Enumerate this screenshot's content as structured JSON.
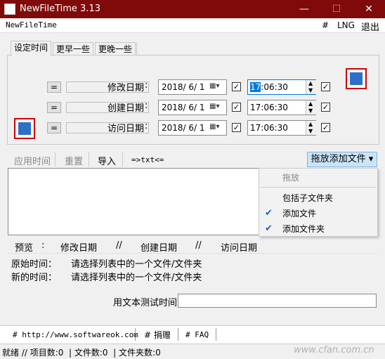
{
  "window": {
    "title": "NewFileTime 3.13",
    "minimize": "—",
    "maximize": "☐",
    "close": "✕"
  },
  "menubar": {
    "app": "NewFileTime",
    "hash": "#",
    "lng": "LNG",
    "exit": "退出"
  },
  "tabs": [
    "设定时间",
    "更早一些",
    "更晚一些"
  ],
  "rows": [
    {
      "eq": "=",
      "label": "修改日期",
      "colon": ":",
      "date": "2018/ 6/ 1",
      "time_hl": "17",
      "time_rest": ":06:30",
      "date_checked": true,
      "time_checked": true
    },
    {
      "eq": "=",
      "label": "创建日期",
      "colon": ":",
      "date": "2018/ 6/ 1",
      "time_hl": "",
      "time_rest": "17:06:30",
      "date_checked": true,
      "time_checked": true
    },
    {
      "eq": "=",
      "label": "访问日期",
      "colon": ":",
      "date": "2018/ 6/ 1",
      "time_hl": "",
      "time_rest": "17:06:30",
      "date_checked": true,
      "time_checked": true
    }
  ],
  "toolbar": {
    "apply": "应用时间",
    "reset": "重置",
    "import": "导入",
    "txt": "=>txt<=",
    "drop": "拖放添加文件 ▾"
  },
  "menu": {
    "header": "拖放",
    "items": [
      {
        "label": "包括子文件夹",
        "checked": false
      },
      {
        "label": "添加文件",
        "checked": true
      },
      {
        "label": "添加文件夹",
        "checked": true
      }
    ]
  },
  "info": {
    "preview": "预览",
    "colon": ":",
    "modified": "修改日期",
    "sep1": "//",
    "created": "创建日期",
    "sep2": "//",
    "accessed": "访问日期",
    "original_label": "原始时间：",
    "original_value": "请选择列表中的一个文件/文件夹",
    "new_label": "新的时间：",
    "new_value": "请选择列表中的一个文件/文件夹",
    "test_label": "用文本测试时间"
  },
  "links": {
    "site": "# http://www.softwareok.com",
    "donate": "# 捐赠",
    "faq": "# FAQ"
  },
  "status": "就绪 // 项目数:0  | 文件数:0  | 文件夹数:0",
  "watermark": "www.cfan.com.cn"
}
